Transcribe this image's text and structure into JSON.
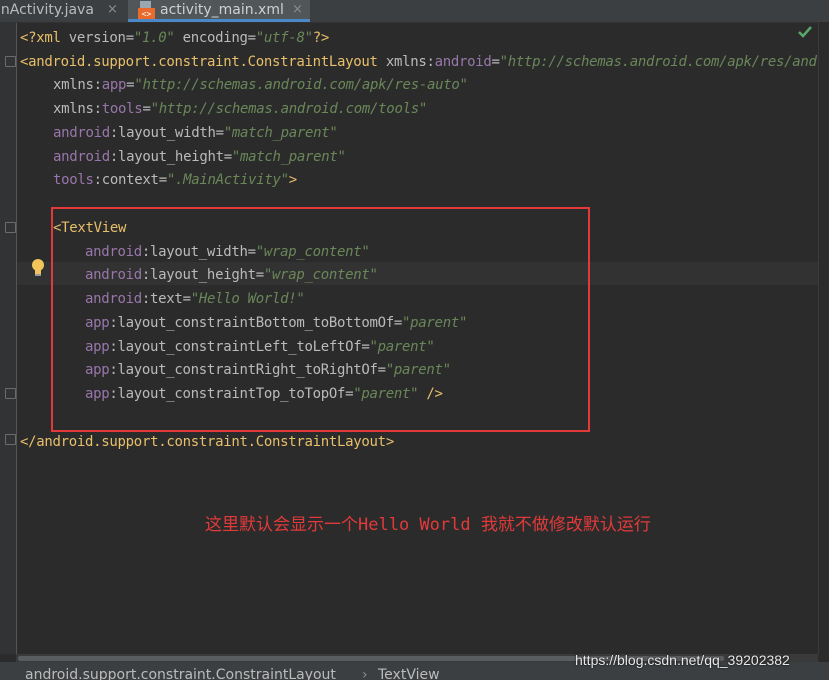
{
  "tabs": [
    {
      "label": "inActivity.java",
      "active": false
    },
    {
      "label": "activity_main.xml",
      "active": true
    }
  ],
  "tab_close_glyph": "×",
  "code": {
    "line1": {
      "open": "<?xml ",
      "a1": "version",
      "eq1": "=",
      "v1": "\"1.0\"",
      "sp": " ",
      "a2": "encoding",
      "eq2": "=",
      "v2": "\"utf-8\"",
      "close": "?>"
    },
    "line2": {
      "open": "<",
      "tag": "android.support.constraint.ConstraintLayout",
      "sp": " ",
      "attr": "xmlns:",
      "ns": "android",
      "eq": "=",
      "val": "\"http://schemas.android.com/apk/res/andro"
    },
    "line3": {
      "attr": "xmlns:",
      "ns": "app",
      "eq": "=",
      "val": "\"http://schemas.android.com/apk/res-auto\""
    },
    "line4": {
      "attr": "xmlns:",
      "ns": "tools",
      "eq": "=",
      "val": "\"http://schemas.android.com/tools\""
    },
    "line5": {
      "ns": "android",
      "attr": ":layout_width",
      "eq": "=",
      "val": "\"match_parent\""
    },
    "line6": {
      "ns": "android",
      "attr": ":layout_height",
      "eq": "=",
      "val": "\"match_parent\""
    },
    "line7": {
      "ns": "tools",
      "attr": ":context",
      "eq": "=",
      "val": "\".MainActivity\"",
      "close": ">"
    },
    "line9": {
      "open": "<",
      "tag": "TextView"
    },
    "line10": {
      "ns": "android",
      "attr": ":layout_width",
      "eq": "=",
      "val": "\"wrap_content\""
    },
    "line11": {
      "ns": "android",
      "attr": ":layout_height",
      "eq": "=",
      "val": "\"wrap_content\""
    },
    "line12": {
      "ns": "android",
      "attr": ":text",
      "eq": "=",
      "val": "\"Hello World!\""
    },
    "line13": {
      "ns": "app",
      "attr": ":layout_constraintBottom_toBottomOf",
      "eq": "=",
      "val": "\"parent\""
    },
    "line14": {
      "ns": "app",
      "attr": ":layout_constraintLeft_toLeftOf",
      "eq": "=",
      "val": "\"parent\""
    },
    "line15": {
      "ns": "app",
      "attr": ":layout_constraintRight_toRightOf",
      "eq": "=",
      "val": "\"parent\""
    },
    "line16": {
      "ns": "app",
      "attr": ":layout_constraintTop_toTopOf",
      "eq": "=",
      "val": "\"parent\"",
      "close": " />"
    },
    "line18": {
      "open": "</",
      "tag": "android.support.constraint.ConstraintLayout",
      "close": ">"
    }
  },
  "annotation": "这里默认会显示一个Hello World 我就不做修改默认运行",
  "breadcrumb": {
    "item1": "android.support.constraint.ConstraintLayout",
    "separator": "›",
    "item2": "TextView"
  },
  "watermark": "https://blog.csdn.net/qq_39202382",
  "colors": {
    "background": "#2b2b2b",
    "tag": "#e8bf6a",
    "namespace": "#9876aa",
    "string": "#6a8759",
    "highlight_box": "#e23a3a",
    "annotation": "#e23a3a"
  },
  "icons": [
    "xml-file-icon",
    "close-icon",
    "check-icon",
    "lightbulb-icon",
    "fold-marker-icon"
  ]
}
